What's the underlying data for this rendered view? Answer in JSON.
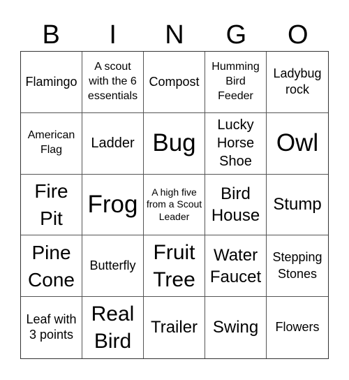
{
  "title_letters": [
    "B",
    "I",
    "N",
    "G",
    "O"
  ],
  "cells": [
    [
      "Flamingo",
      "A scout with the 6 essentials",
      "Compost",
      "Humming Bird Feeder",
      "Ladybug rock"
    ],
    [
      "American Flag",
      "Ladder",
      "Bug",
      "Lucky Horse Shoe",
      "Owl"
    ],
    [
      "Fire Pit",
      "Frog",
      "A high five from a Scout Leader",
      "Bird House",
      "Stump"
    ],
    [
      "Pine Cone",
      "Butterfly",
      "Fruit Tree",
      "Water Faucet",
      "Stepping Stones"
    ],
    [
      "Leaf with 3 points",
      "Real Bird",
      "Trailer",
      "Swing",
      "Flowers"
    ]
  ]
}
